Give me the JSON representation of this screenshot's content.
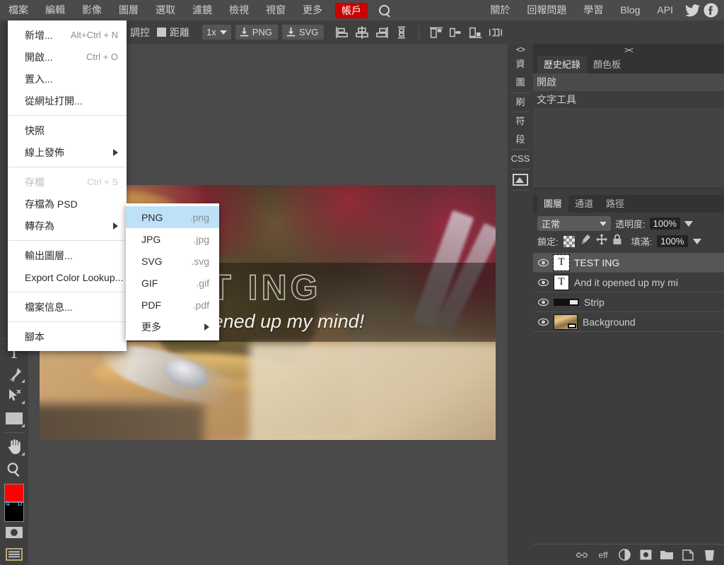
{
  "menubar": {
    "left_items": [
      {
        "label": "檔案",
        "name": "menu-file",
        "active": true
      },
      {
        "label": "編輯",
        "name": "menu-edit"
      },
      {
        "label": "影像",
        "name": "menu-image"
      },
      {
        "label": "圖層",
        "name": "menu-layer"
      },
      {
        "label": "選取",
        "name": "menu-select"
      },
      {
        "label": "濾鏡",
        "name": "menu-filter"
      },
      {
        "label": "檢視",
        "name": "menu-view"
      },
      {
        "label": "視窗",
        "name": "menu-window"
      },
      {
        "label": "更多",
        "name": "menu-more"
      }
    ],
    "account_label": "帳戶",
    "account_color": "#cc0000",
    "search_icon": "search-icon",
    "right_items": [
      {
        "label": "關於",
        "name": "menu-about"
      },
      {
        "label": "回報問題",
        "name": "menu-report-issue"
      },
      {
        "label": "學習",
        "name": "menu-learn"
      },
      {
        "label": "Blog",
        "name": "menu-blog"
      },
      {
        "label": "API",
        "name": "menu-api"
      }
    ],
    "social": [
      {
        "name": "twitter-icon"
      },
      {
        "name": "facebook-icon"
      }
    ]
  },
  "optionsbar": {
    "tool_label": "調控",
    "distance_label": "距離",
    "zoom_value": "1x",
    "export_png": "PNG",
    "export_svg": "SVG",
    "align_icons": [
      "align-left-icon",
      "align-center-horizontal-icon",
      "align-right-icon",
      "distribute-vertical-icon",
      "align-top-icon",
      "align-middle-icon",
      "align-bottom-icon",
      "distribute-horizontal-icon"
    ]
  },
  "file_menu": {
    "items": [
      {
        "label": "新增...",
        "shortcut": "Alt+Ctrl + N",
        "name": "menu-item-new"
      },
      {
        "label": "開啟...",
        "shortcut": "Ctrl + O",
        "name": "menu-item-open"
      },
      {
        "label": "置入...",
        "shortcut": "",
        "name": "menu-item-place"
      },
      {
        "label": "從網址打開...",
        "shortcut": "",
        "name": "menu-item-open-from-url"
      },
      {
        "separator": true
      },
      {
        "label": "快照",
        "shortcut": "",
        "name": "menu-item-snapshot"
      },
      {
        "label": "線上發佈",
        "shortcut": "",
        "submenu": true,
        "name": "menu-item-publish-online"
      },
      {
        "separator": true
      },
      {
        "label": "存檔",
        "shortcut": "Ctrl + S",
        "disabled": true,
        "name": "menu-item-save"
      },
      {
        "label": "存檔為 PSD",
        "shortcut": "",
        "name": "menu-item-save-as-psd"
      },
      {
        "label": "轉存為",
        "shortcut": "",
        "submenu": true,
        "name": "menu-item-export-as"
      },
      {
        "separator": true
      },
      {
        "label": "輸出圖層...",
        "shortcut": "",
        "name": "menu-item-export-layers"
      },
      {
        "label": "Export Color Lookup...",
        "shortcut": "",
        "name": "menu-item-export-color-lookup"
      },
      {
        "separator": true
      },
      {
        "label": "檔案信息...",
        "shortcut": "",
        "name": "menu-item-file-info"
      },
      {
        "separator": true
      },
      {
        "label": "腳本",
        "shortcut": "",
        "name": "menu-item-scripts"
      }
    ]
  },
  "export_submenu": {
    "items": [
      {
        "label": "PNG",
        "ext": ".png",
        "selected": true,
        "name": "submenu-item-png"
      },
      {
        "label": "JPG",
        "ext": ".jpg",
        "name": "submenu-item-jpg"
      },
      {
        "label": "SVG",
        "ext": ".svg",
        "name": "submenu-item-svg"
      },
      {
        "label": "GIF",
        "ext": ".gif",
        "name": "submenu-item-gif"
      },
      {
        "label": "PDF",
        "ext": ".pdf",
        "name": "submenu-item-pdf"
      },
      {
        "label": "更多",
        "ext": "",
        "submenu": true,
        "name": "submenu-item-more"
      }
    ]
  },
  "tools": [
    {
      "name": "tool-magic-wand",
      "icon": "magic-wand-icon"
    },
    {
      "name": "tool-type",
      "icon": "type-icon"
    },
    {
      "name": "tool-pen",
      "icon": "pen-icon"
    },
    {
      "name": "tool-path-select",
      "icon": "path-select-icon"
    },
    {
      "name": "tool-shape",
      "icon": "rectangle-shape-icon"
    },
    {
      "name": "tool-hand",
      "icon": "hand-icon"
    },
    {
      "name": "tool-zoom",
      "icon": "zoom-icon"
    }
  ],
  "swatches": {
    "foreground": "#ff0000",
    "background": "#000000",
    "swap_label": "⇅",
    "default_label": "D",
    "quickmask_icon": "quick-mask-icon",
    "screenmode_icon": "screen-mode-icon"
  },
  "vertical_tabs": {
    "collapse_glyph": "<>",
    "items": [
      {
        "label": "資",
        "name": "vtab-info"
      },
      {
        "label": "圖",
        "name": "vtab-layer"
      },
      {
        "label": "刷",
        "name": "vtab-brush"
      },
      {
        "label": "符",
        "name": "vtab-glyph"
      },
      {
        "label": "段",
        "name": "vtab-paragraph"
      },
      {
        "label": "CSS",
        "name": "vtab-css"
      },
      {
        "label": "",
        "name": "vtab-image",
        "icon": "image-icon"
      }
    ]
  },
  "history_panel": {
    "collapse_glyph": "><",
    "tabs": [
      {
        "label": "歷史紀錄",
        "name": "tab-history",
        "active": true
      },
      {
        "label": "顏色板",
        "name": "tab-swatches",
        "active": false
      }
    ],
    "entries": [
      {
        "label": "開啟",
        "name": "history-item-open",
        "current": true
      },
      {
        "label": "文字工具",
        "name": "history-item-type-tool",
        "current": false
      }
    ]
  },
  "layers_panel": {
    "tabs": [
      {
        "label": "圖層",
        "name": "tab-layers",
        "active": true
      },
      {
        "label": "通道",
        "name": "tab-channels",
        "active": false
      },
      {
        "label": "路徑",
        "name": "tab-paths",
        "active": false
      }
    ],
    "blend_mode": "正常",
    "opacity_label": "透明度:",
    "opacity_value": "100%",
    "lock_label": "鎖定:",
    "fill_label": "填滿:",
    "fill_value": "100%",
    "lock_icons": [
      "lock-transparency-icon",
      "lock-paint-icon",
      "lock-move-icon",
      "lock-all-icon"
    ],
    "layers": [
      {
        "name_text": "TEST ING",
        "thumb": "type-thumb",
        "selected": true,
        "visible": true,
        "name": "layer-row-test-ing"
      },
      {
        "name_text": "And it opened up my mi",
        "thumb": "type-thumb",
        "selected": false,
        "visible": true,
        "name": "layer-row-and-it-opened"
      },
      {
        "name_text": "Strip",
        "thumb": "strip-thumb",
        "selected": false,
        "visible": true,
        "name": "layer-row-strip"
      },
      {
        "name_text": "Background",
        "thumb": "image-thumb",
        "selected": false,
        "visible": true,
        "name": "layer-row-background"
      }
    ],
    "bottom_icons": [
      {
        "label": "link-layers-icon",
        "glyph": "⛓",
        "name": "link-layers-button"
      },
      {
        "label": "layer-effects-icon",
        "glyph": "eff",
        "name": "layer-effects-button"
      },
      {
        "label": "adjustment-layer-icon",
        "glyph": "",
        "name": "adjustment-layer-button"
      },
      {
        "label": "layer-mask-icon",
        "glyph": "",
        "name": "layer-mask-button"
      },
      {
        "label": "new-group-icon",
        "glyph": "",
        "name": "new-group-button"
      },
      {
        "label": "new-layer-icon",
        "glyph": "",
        "name": "new-layer-button"
      },
      {
        "label": "delete-layer-icon",
        "glyph": "",
        "name": "delete-layer-button"
      }
    ]
  },
  "canvas": {
    "title_text": "TEST ING",
    "subtitle_text": "And it opened up my mind!"
  }
}
